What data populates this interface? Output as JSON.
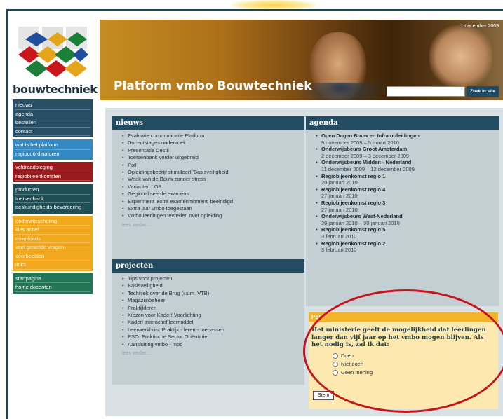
{
  "site": {
    "logo_text": "bouwtechniek",
    "title": "Platform vmbo Bouwtechniek",
    "date": "1 december 2009",
    "search_button": "Zoek in site"
  },
  "sidebar": {
    "groups": [
      {
        "color": "#264e64",
        "items": [
          "nieuws",
          "agenda",
          "bestellen",
          "contact"
        ]
      },
      {
        "color": "#3289c4",
        "items": [
          "wat is het platform",
          "regiocoördinatoren"
        ]
      },
      {
        "color": "#9a1b1d",
        "items": [
          "veldraadpleging",
          "regiobijeenkomsten"
        ]
      },
      {
        "color": "#1e4f56",
        "items": [
          "producten",
          "toetsenbank",
          "deskundigheids-bevordering"
        ]
      },
      {
        "color": "#f0a81e",
        "items": [
          "onderwijsscholing",
          "kies actief",
          "downloads",
          "veel gestelde vragen",
          "voorbeelden",
          "links"
        ]
      },
      {
        "color": "#227556",
        "items": [
          "startpagina",
          "home docenten"
        ]
      }
    ]
  },
  "nieuws": {
    "title": "nieuws",
    "items": [
      "Evaluatie communicatie Platform",
      "Docentstages onderzoek",
      "Presentatie Destil",
      "Toetsenbank verder uitgebreid",
      "Poll",
      "Opleidingsbedrijf stimuleert 'Basisveiligheid'",
      "Week van de Bouw zonder stress",
      "Varianten LOB",
      "Geglobaliseerde examens",
      "Experiment 'extra examenmoment' beëindigd",
      "Extra jaar vmbo toegestaan",
      "Vmbo leerlingen tevreden over opleiding"
    ],
    "more": "lees verder..."
  },
  "projecten": {
    "title": "projecten",
    "items": [
      "Tips voor projecten",
      "Basisveiligheid",
      "Techniek over de Brug (i.s.m. VTB)",
      "Magazijnbeheer",
      "Praktijkleren",
      "Kiezen voor Kader! Voorlichting",
      "Kader! interactief leermiddel",
      "Leerwerkhuis: Praktijk - leren - toepassen",
      "PSO: Praktische Sector Oriëntatie",
      "Aansluiting vmbo - mbo"
    ],
    "more": "lees verder..."
  },
  "agenda": {
    "title": "agenda",
    "events": [
      {
        "name": "Open Dagen Bouw en Infra opleidingen",
        "date": "9 november 2009 – 5 maart 2010"
      },
      {
        "name": "Onderwijsbeurs Groot Amsterdam",
        "date": "2 december 2009 – 3 december 2009"
      },
      {
        "name": "Onderwijsbeurs Midden - Nederland",
        "date": "11 december 2009 – 12 december 2009"
      },
      {
        "name": "Regiobijeenkomst regio 1",
        "date": "20 januari 2010"
      },
      {
        "name": "Regiobijeenkomst regio 4",
        "date": "27 januari 2010"
      },
      {
        "name": "Regiobijeenkomst regio 3",
        "date": "27 januari 2010"
      },
      {
        "name": "Onderwijsbeurs West-Nederland",
        "date": "29 januari 2010 – 30 januari 2010"
      },
      {
        "name": "Regiobijeenkomst regio 5",
        "date": "3 februari 2010"
      },
      {
        "name": "Regiobijeenkomst regio 2",
        "date": "3 februari 2010"
      }
    ]
  },
  "poll": {
    "title": "Poll",
    "question": "Het ministerie geeft de mogelijkheid dat leerlingen langer dan vijf jaar op het vmbo mogen blijven. Als het nodig is, zal ik dat:",
    "options": [
      "Doen",
      "Niet doen",
      "Geen mening"
    ],
    "submit": "Stem"
  },
  "colors": {
    "dark_teal": "#1d4453",
    "panel_head": "#234b62",
    "poll_bg": "#fde9b0",
    "annotation_circle": "#c4161c"
  }
}
